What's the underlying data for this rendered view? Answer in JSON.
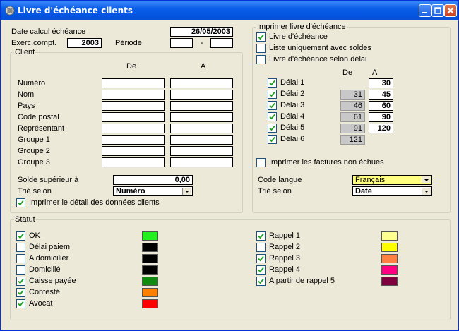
{
  "window": {
    "title": "Livre d'échéance clients"
  },
  "top": {
    "date_label": "Date calcul échéance",
    "date_value": "26/05/2003",
    "exerc_label": "Exerc.compt.",
    "exerc_value": "2003",
    "periode_label": "Période",
    "periode_from": "",
    "periode_sep": "-",
    "periode_to": ""
  },
  "client": {
    "title": "Client",
    "col_from": "De",
    "col_to": "A",
    "rows": [
      {
        "label": "Numéro",
        "from": "",
        "to": ""
      },
      {
        "label": "Nom",
        "from": "",
        "to": ""
      },
      {
        "label": "Pays",
        "from": "",
        "to": ""
      },
      {
        "label": "Code postal",
        "from": "",
        "to": ""
      },
      {
        "label": "Représentant",
        "from": "",
        "to": ""
      },
      {
        "label": "Groupe 1",
        "from": "",
        "to": ""
      },
      {
        "label": "Groupe 2",
        "from": "",
        "to": ""
      },
      {
        "label": "Groupe 3",
        "from": "",
        "to": ""
      }
    ],
    "solde_label": "Solde supérieur à",
    "solde_value": "0,00",
    "trie_label": "Trié selon",
    "trie_value": "Numéro",
    "detail_label": "Imprimer le détail des données clients",
    "detail_checked": true
  },
  "imprimer": {
    "title": "Imprimer livre d'échéance",
    "options": [
      {
        "label": "Livre d'échéance",
        "checked": true
      },
      {
        "label": "Liste uniquement avec soldes",
        "checked": false
      },
      {
        "label": "Livre d'échéance selon délai",
        "checked": false
      }
    ],
    "col_from": "De",
    "col_to": "A",
    "delais": [
      {
        "label": "Délai 1",
        "checked": true,
        "from": "",
        "to": "30"
      },
      {
        "label": "Délai 2",
        "checked": true,
        "from": "31",
        "to": "45"
      },
      {
        "label": "Délai 3",
        "checked": true,
        "from": "46",
        "to": "60"
      },
      {
        "label": "Délai 4",
        "checked": true,
        "from": "61",
        "to": "90"
      },
      {
        "label": "Délai 5",
        "checked": true,
        "from": "91",
        "to": "120"
      },
      {
        "label": "Délai 6",
        "checked": true,
        "from": "121",
        "to": ""
      }
    ],
    "non_echues_label": "Imprimer les factures non échues",
    "non_echues_checked": false,
    "langue_label": "Code langue",
    "langue_value": "Français",
    "trie_label": "Trié selon",
    "trie_value": "Date"
  },
  "statut": {
    "title": "Statut",
    "left": [
      {
        "label": "OK",
        "checked": true,
        "color": "#22ee22"
      },
      {
        "label": "Délai paiem",
        "checked": false,
        "color": "#000000"
      },
      {
        "label": "A domicilier",
        "checked": false,
        "color": "#000000"
      },
      {
        "label": "Domicilié",
        "checked": false,
        "color": "#000000"
      },
      {
        "label": "Caisse payée",
        "checked": true,
        "color": "#128a12"
      },
      {
        "label": "Contesté",
        "checked": true,
        "color": "#ff8000"
      },
      {
        "label": "Avocat",
        "checked": true,
        "color": "#ff0000"
      }
    ],
    "right": [
      {
        "label": "Rappel 1",
        "checked": true,
        "color": "#ffff90"
      },
      {
        "label": "Rappel 2",
        "checked": false,
        "color": "#ffff00"
      },
      {
        "label": "Rappel 3",
        "checked": true,
        "color": "#ff8040"
      },
      {
        "label": "Rappel 4",
        "checked": true,
        "color": "#ff0080"
      },
      {
        "label": "A partir de rappel 5",
        "checked": true,
        "color": "#800040"
      }
    ]
  }
}
